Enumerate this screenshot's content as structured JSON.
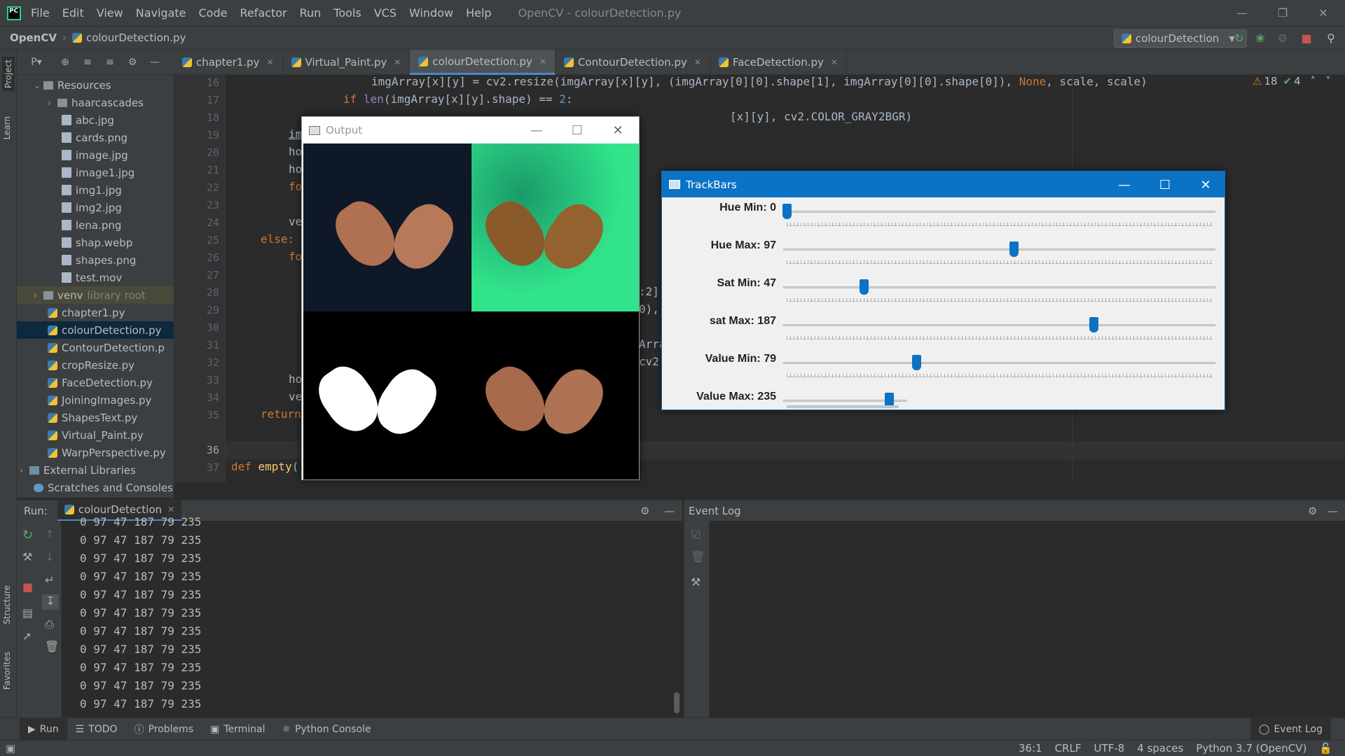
{
  "menubar": {
    "items": [
      "File",
      "Edit",
      "View",
      "Navigate",
      "Code",
      "Refactor",
      "Run",
      "Tools",
      "VCS",
      "Window",
      "Help"
    ],
    "window_title": "OpenCV - colourDetection.py"
  },
  "navbar": {
    "project": "OpenCV",
    "file": "colourDetection.py",
    "run_config": "colourDetection"
  },
  "left_stripe": {
    "project": "Project",
    "learn": "Learn",
    "structure": "Structure",
    "favorites": "Favorites"
  },
  "project_header": {
    "label": "P▾"
  },
  "tree": [
    {
      "label": "Resources",
      "extra": ""
    },
    {
      "label": "haarcascades",
      "extra": ""
    },
    {
      "label": "abc.jpg",
      "extra": ""
    },
    {
      "label": "cards.png",
      "extra": ""
    },
    {
      "label": "image.jpg",
      "extra": ""
    },
    {
      "label": "image1.jpg",
      "extra": ""
    },
    {
      "label": "img1.jpg",
      "extra": ""
    },
    {
      "label": "img2.jpg",
      "extra": ""
    },
    {
      "label": "lena.png",
      "extra": ""
    },
    {
      "label": "shap.webp",
      "extra": ""
    },
    {
      "label": "shapes.png",
      "extra": ""
    },
    {
      "label": "test.mov",
      "extra": ""
    },
    {
      "label": "venv",
      "extra": "library root"
    },
    {
      "label": "chapter1.py",
      "extra": ""
    },
    {
      "label": "colourDetection.py",
      "extra": ""
    },
    {
      "label": "ContourDetection.p",
      "extra": ""
    },
    {
      "label": "cropResize.py",
      "extra": ""
    },
    {
      "label": "FaceDetection.py",
      "extra": ""
    },
    {
      "label": "JoiningImages.py",
      "extra": ""
    },
    {
      "label": "ShapesText.py",
      "extra": ""
    },
    {
      "label": "Virtual_Paint.py",
      "extra": ""
    },
    {
      "label": "WarpPerspective.py",
      "extra": ""
    },
    {
      "label": "External Libraries",
      "extra": ""
    },
    {
      "label": "Scratches and Consoles",
      "extra": ""
    }
  ],
  "tabs": [
    "chapter1.py",
    "Virtual_Paint.py",
    "colourDetection.py",
    "ContourDetection.py",
    "FaceDetection.py"
  ],
  "inspections": {
    "warnings": "18",
    "ok": "4"
  },
  "line_numbers": [
    "16",
    "17",
    "18",
    "19",
    "20",
    "21",
    "22",
    "23",
    "24",
    "25",
    "26",
    "27",
    "28",
    "29",
    "30",
    "31",
    "32",
    "33",
    "34",
    "35",
    "36",
    "37"
  ],
  "code": {
    "l16_a": "imgArray[x][y] = cv2.resize(imgArray[x][y], (imgArray[0][0].shape[1], imgArray[0][0].shape[0]), ",
    "l16_b": "None",
    "l16_c": ", scale, scale)",
    "l17_kw": "if ",
    "l17_a": "len",
    "l17_b": "(imgArray[x][y].shape) == ",
    "l17_num": "2",
    "l17_c": ":",
    "l18": "[x][y], cv2.COLOR_GRAY2BGR)",
    "l19": "im",
    "l19_r": ")",
    "l20": "ho",
    "l21": "ho",
    "l22": "fo",
    "l24": "ve",
    "l25": "else:",
    "l26": "fo",
    "l27": ":2]",
    "l28": "0),",
    "l30": "Arra",
    "l31": "cv2",
    "l32": "ho",
    "l33": "ve",
    "l34": "return",
    "l37_kw": "def ",
    "l37_fn": "empty",
    "l37_r": "("
  },
  "run_panel": {
    "label": "Run:",
    "tab": "colourDetection",
    "lines": [
      "0 97 47 187 79 235",
      "0 97 47 187 79 235",
      "0 97 47 187 79 235",
      "0 97 47 187 79 235",
      "0 97 47 187 79 235",
      "0 97 47 187 79 235",
      "0 97 47 187 79 235",
      "0 97 47 187 79 235",
      "0 97 47 187 79 235",
      "0 97 47 187 79 235",
      "0 97 47 187 79 235"
    ]
  },
  "event_log": {
    "title": "Event Log"
  },
  "bottom_tabs": [
    "Run",
    "TODO",
    "Problems",
    "Terminal",
    "Python Console"
  ],
  "event_log_button": "Event Log",
  "status": {
    "position": "36:1",
    "line_sep": "CRLF",
    "encoding": "UTF-8",
    "indent": "4 spaces",
    "interpreter": "Python 3.7 (OpenCV)"
  },
  "output_window": {
    "title": "Output"
  },
  "trackbars": {
    "title": "TrackBars",
    "bars": [
      {
        "label": "Hue Min: 0",
        "value": 0,
        "max": 179
      },
      {
        "label": "Hue Max: 97",
        "value": 97,
        "max": 179
      },
      {
        "label": "Sat Min: 47",
        "value": 47,
        "max": 255
      },
      {
        "label": "sat Max: 187",
        "value": 187,
        "max": 255
      },
      {
        "label": "Value Min: 79",
        "value": 79,
        "max": 255
      },
      {
        "label": "Value Max: 235",
        "value": 235,
        "max": 255
      }
    ]
  },
  "colors": {
    "accent": "#0a73c6",
    "ide_bg": "#2b2b2b",
    "panel_bg": "#3c3f41",
    "selection": "#0d293e"
  }
}
